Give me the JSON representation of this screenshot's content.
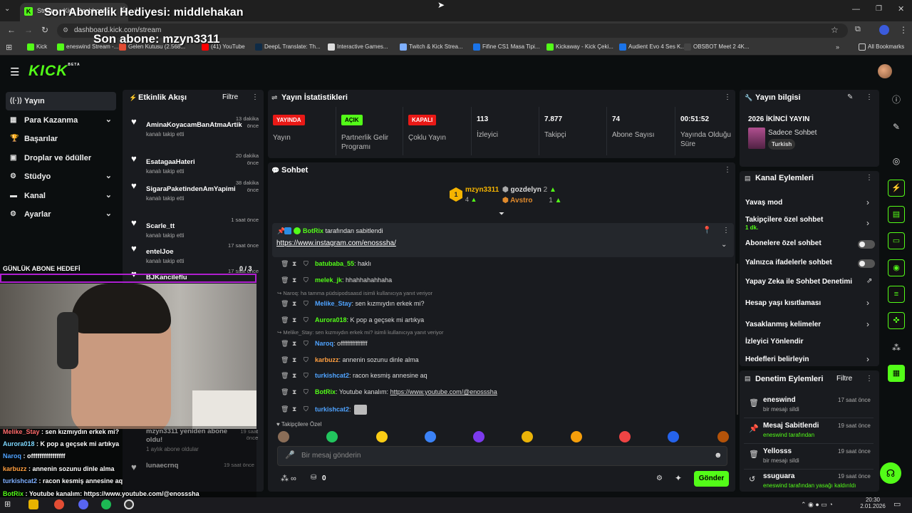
{
  "browser": {
    "tab_title": "Stream - Kick Dashboard",
    "url": "dashboard.kick.com/stream",
    "bookmarks": [
      "Kick",
      "eneswind Stream -...",
      "Gelen Kutusu (2.568...",
      "(41) YouTube",
      "DeepL Translate: Th...",
      "Interactive Games...",
      "Twitch & Kick Strea...",
      "Fifine CS1 Masa Tipi...",
      "Kickaway - Kick Çeki...",
      "Audient Evo 4 Ses K...",
      "OBSBOT Meet 2 4K..."
    ],
    "all_bookmarks": "All Bookmarks",
    "more": "»"
  },
  "overlay": {
    "last_gift": "Son Abonelik Hediyesi: middlehakan",
    "last_sub": "Son abone: mzyn3311",
    "sub_goal_label": "GÜNLÜK ABONE HEDEFİ",
    "sub_goal_value": "0 / 3",
    "chat": [
      {
        "user": "Melike_Stay",
        "msg": " : sen kızmıydın erkek mi?",
        "color": "#ff6b6b"
      },
      {
        "user": "Aurora018",
        "msg": " : K pop a geçsek mi artıkya",
        "color": "#7fd9ff"
      },
      {
        "user": "Naroq",
        "msg": " : offffffffffffffff",
        "color": "#4fa3ff"
      },
      {
        "user": "karbuzz",
        "msg": " : annenin sozunu dinle alma",
        "color": "#ff9f40"
      },
      {
        "user": "turkishcat2",
        "msg": " : racon kesmiş annesine aq",
        "color": "#7fb0ff"
      },
      {
        "user": "BotRix",
        "msg": " : Youtube kanalım: https://www.youtube.com/@enosssha",
        "color": "#53fc18"
      },
      {
        "user": "turkishcat2",
        "msg": " :",
        "color": "#7fb0ff"
      }
    ]
  },
  "header": {
    "logo": "KICK",
    "beta": "BETA"
  },
  "sidebar": {
    "items": [
      {
        "label": "Yayın",
        "icon": "((·))",
        "chev": false,
        "active": true
      },
      {
        "label": "Para Kazanma",
        "icon": "▦",
        "chev": true
      },
      {
        "label": "Başarılar",
        "icon": "🏆",
        "chev": false
      },
      {
        "label": "Droplar ve ödüller",
        "icon": "▣",
        "chev": false
      },
      {
        "label": "Stüdyo",
        "icon": "⚙",
        "chev": true
      },
      {
        "label": "Kanal",
        "icon": "▬",
        "chev": true
      },
      {
        "label": "Ayarlar",
        "icon": "⚙",
        "chev": true
      }
    ]
  },
  "activity": {
    "title": "Etkinlik Akışı",
    "filter": "Filtre",
    "items": [
      {
        "name": "AminaKoyacamBanAtmaArtik",
        "action": "kanalı takip etti",
        "time": "13 dakika önce"
      },
      {
        "name": "EsatagaaHateri",
        "action": "kanalı takip etti",
        "time": "20 dakika önce"
      },
      {
        "name": "SigaraPaketindenAmYapimi",
        "action": "kanalı takip etti",
        "time": "38 dakika önce"
      },
      {
        "name": "Scarle_tt",
        "action": "kanalı takip etti",
        "time": "1 saat önce"
      },
      {
        "name": "entelJoe",
        "action": "kanalı takip etti",
        "time": "17 saat önce"
      },
      {
        "name": "BJKanciIeflu",
        "action": "kanalı takip etti",
        "time": "17 saat önce"
      }
    ],
    "bottom_items": [
      {
        "name": "mzyn3311 yeniden abone oldu!",
        "action": "1 aylık abone oldular",
        "time": "19 saat önce"
      },
      {
        "name": "lunaecrnq",
        "action": "",
        "time": "19 saat önce"
      }
    ]
  },
  "stats": {
    "title": "Yayın İstatistikleri",
    "cols": [
      {
        "badge": "YAYINDA",
        "badge_color": "#e91916",
        "label": "Yayın"
      },
      {
        "badge": "AÇIK",
        "badge_color": "#53fc18",
        "label": "Partnerlik Gelir Programı"
      },
      {
        "badge": "KAPALI",
        "badge_color": "#e91916",
        "label": "Çoklu Yayın"
      },
      {
        "value": "113",
        "label": "İzleyici"
      },
      {
        "value": "7.877",
        "label": "Takipçi"
      },
      {
        "value": "74",
        "label": "Abone Sayısı"
      },
      {
        "value": "00:51:52",
        "label": "Yayında Olduğu Süre"
      }
    ]
  },
  "chat": {
    "title": "Sohbet",
    "leaderboard": [
      {
        "name": "mzyn3311",
        "count": "4"
      },
      {
        "name": "gozdelyn",
        "count": "2"
      },
      {
        "name": "Avstro",
        "count": "1"
      }
    ],
    "pinned": {
      "by": "BotRix",
      "by_suffix": "tarafından sabitlendi",
      "link": "https://www.instagram.com/enosssha/"
    },
    "messages": [
      {
        "user": "batubaba_55",
        "text": ": haklı",
        "color": "#53fc18",
        "reply": ""
      },
      {
        "user": "melek_jk",
        "text": ": hhahhahahhaha",
        "color": "#53fc18",
        "reply": ""
      },
      {
        "user": "Melike_Stay",
        "text": ": sen kızmıydın erkek mi?",
        "color": "#4fa3ff",
        "reply": "Naroq: ha tamma püdsipodsaasd isimli kullanıcıya yanıt veriyor"
      },
      {
        "user": "Aurora018",
        "text": ": K pop a geçsek mi artıkya",
        "color": "#53fc18",
        "reply": ""
      },
      {
        "user": "Naroq",
        "text": ": offffffffffffffff",
        "color": "#4fa3ff",
        "reply": "Melike_Stay: sen kızmıydın erkek mi? isimli kullanıcıya yanıt veriyor"
      },
      {
        "user": "karbuzz",
        "text": ": annenin sozunu dinle alma",
        "color": "#ff9f40",
        "reply": ""
      },
      {
        "user": "turkishcat2",
        "text": ": racon kesmiş annesine aq",
        "color": "#4fa3ff",
        "reply": ""
      },
      {
        "user": "BotRix",
        "text": ": Youtube kanalım: ",
        "link": "https://www.youtube.com/@enosssha",
        "color": "#53fc18",
        "reply": ""
      },
      {
        "user": "turkishcat2",
        "text": ":",
        "color": "#4fa3ff",
        "reply": ""
      }
    ],
    "followers_only_label": "Takipçilere Özel",
    "input_placeholder": "Bir mesaj gönderin",
    "points": "0",
    "send": "Gönder"
  },
  "stream_info": {
    "title": "Yayın bilgisi",
    "stream_title": "2026 İKİNCİ YAYIN",
    "category": "Sadece Sohbet",
    "tag": "Turkish"
  },
  "channel_actions": {
    "title": "Kanal Eylemleri",
    "items": [
      {
        "label": "Yavaş mod",
        "type": "chev",
        "sub": ""
      },
      {
        "label": "Takipçilere özel sohbet",
        "type": "chev",
        "sub": "1 dk."
      },
      {
        "label": "Abonelere özel sohbet",
        "type": "toggle",
        "sub": ""
      },
      {
        "label": "Yalnızca ifadelerle sohbet",
        "type": "toggle",
        "sub": ""
      },
      {
        "label": "Yapay Zeka ile Sohbet Denetimi",
        "type": "ext",
        "sub": ""
      },
      {
        "label": "Hesap yaşı kısıtlaması",
        "type": "chev",
        "sub": ""
      },
      {
        "label": "Yasaklanmış kelimeler",
        "type": "chev",
        "sub": ""
      },
      {
        "label": "İzleyici Yönlendir",
        "type": "none",
        "sub": ""
      },
      {
        "label": "Hedefleri belirleyin",
        "type": "chev",
        "sub": ""
      }
    ]
  },
  "mod_actions": {
    "title": "Denetim Eylemleri",
    "filter": "Filtre",
    "items": [
      {
        "name": "eneswind",
        "desc": "bir mesajı sildi",
        "time": "17 saat önce",
        "icon": "🗑"
      },
      {
        "name": "Mesaj Sabitlendi",
        "desc": "eneswind tarafından",
        "time": "19 saat önce",
        "icon": "📌"
      },
      {
        "name": "Yellosss",
        "desc": "bir mesajı sildi",
        "time": "19 saat önce",
        "icon": "🗑"
      },
      {
        "name": "ssuguara",
        "desc": "eneswind tarafından yasağı kaldırıldı",
        "time": "19 saat önce",
        "icon": "↺"
      }
    ]
  },
  "taskbar": {
    "time": "20:30",
    "date": "2.01.2026"
  }
}
